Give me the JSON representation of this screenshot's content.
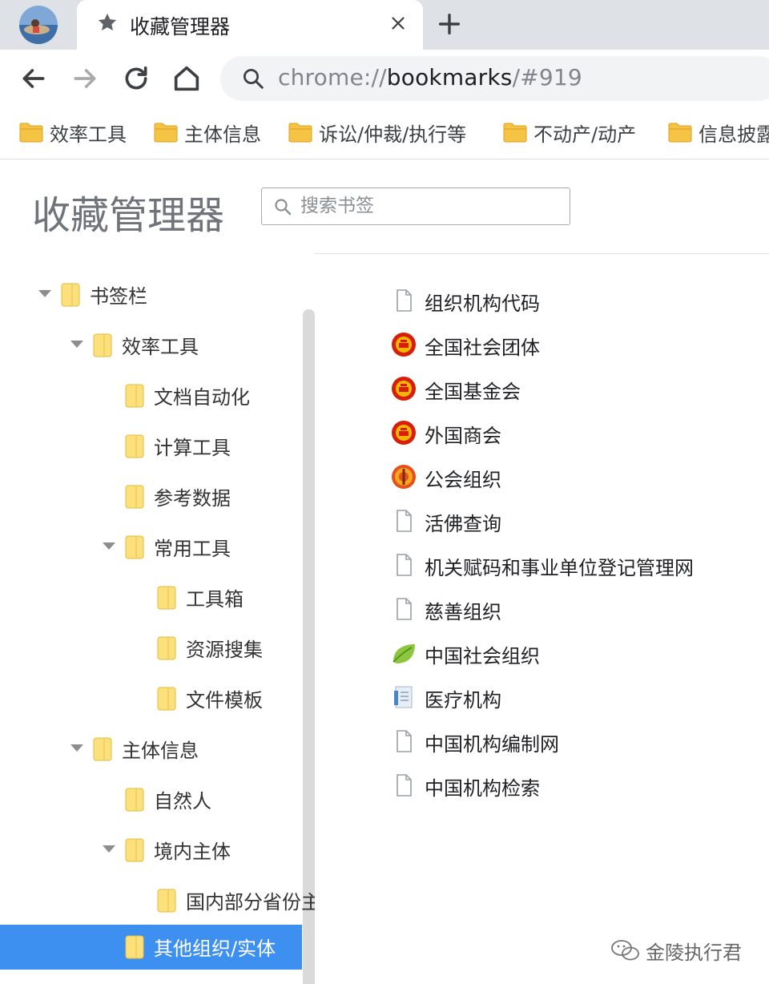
{
  "tab": {
    "title": "收藏管理器"
  },
  "omnibox": {
    "scheme": "chrome://",
    "host": "bookmarks",
    "path": "/#919"
  },
  "bookmarks_bar": [
    {
      "label": "效率工具"
    },
    {
      "label": "主体信息"
    },
    {
      "label": "诉讼/仲裁/执行等"
    },
    {
      "label": "不动产/动产"
    },
    {
      "label": "信息披露"
    }
  ],
  "manager": {
    "title": "收藏管理器",
    "search_placeholder": "搜索书签"
  },
  "tree": [
    {
      "label": "书签栏",
      "expanded": true
    },
    {
      "label": "效率工具",
      "expanded": true
    },
    {
      "label": "文档自动化"
    },
    {
      "label": "计算工具"
    },
    {
      "label": "参考数据"
    },
    {
      "label": "常用工具",
      "expanded": true
    },
    {
      "label": "工具箱"
    },
    {
      "label": "资源搜集"
    },
    {
      "label": "文件模板"
    },
    {
      "label": "主体信息",
      "expanded": true
    },
    {
      "label": "自然人"
    },
    {
      "label": "境内主体",
      "expanded": true
    },
    {
      "label": "国内部分省份主体"
    },
    {
      "label": "其他组织/实体",
      "selected": true
    }
  ],
  "list": [
    {
      "label": "组织机构代码",
      "icon": "page-icon"
    },
    {
      "label": "全国社会团体",
      "icon": "national-emblem-icon"
    },
    {
      "label": "全国基金会",
      "icon": "national-emblem-icon"
    },
    {
      "label": "外国商会",
      "icon": "national-emblem-icon"
    },
    {
      "label": "公会组织",
      "icon": "trade-union-icon"
    },
    {
      "label": "活佛查询",
      "icon": "page-icon"
    },
    {
      "label": "机关赋码和事业单位登记管理网",
      "icon": "page-icon"
    },
    {
      "label": "慈善组织",
      "icon": "page-icon"
    },
    {
      "label": "中国社会组织",
      "icon": "leaf-icon"
    },
    {
      "label": "医疗机构",
      "icon": "document-blue-icon"
    },
    {
      "label": "中国机构编制网",
      "icon": "page-icon"
    },
    {
      "label": "中国机构检索",
      "icon": "page-icon"
    }
  ],
  "watermark": {
    "text": "金陵执行君"
  }
}
